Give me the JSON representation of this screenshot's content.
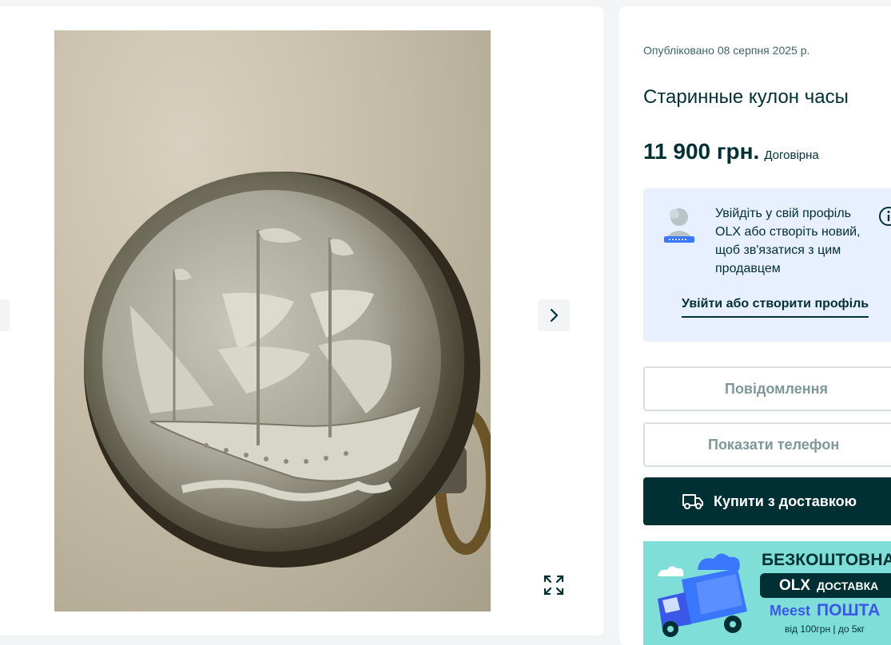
{
  "gallery": {
    "prev_icon": "chevron-left-icon",
    "next_icon": "chevron-right-icon",
    "expand_icon": "expand-icon"
  },
  "ad": {
    "published": "Опубліковано 08 серпня 2025 р.",
    "title": "Старинные кулон часы",
    "price": "11 900 грн.",
    "negotiable": "Договірна"
  },
  "login_prompt": {
    "text": "Увійдіть у свій профіль OLX або створіть новий, щоб зв'язатися з цим продавцем",
    "link": "Увійти або створити профіль",
    "info_icon": "info-icon"
  },
  "actions": {
    "message": "Повідомлення",
    "phone": "Показати телефон",
    "buy": "Купити з доставкою",
    "buy_icon": "truck-icon"
  },
  "banner": {
    "headline": "БЕЗКОШТОВНА",
    "olx_logo": "OLX",
    "olx_label": "ДОСТАВКА",
    "meest_logo": "Meest",
    "meest_poshta": "ПОШТА",
    "terms": "від 100грн | до 5кг"
  },
  "colors": {
    "primary": "#002f34",
    "login_bg": "#e8efff",
    "banner_bg": "#7fded8",
    "meest_blue": "#3a57e8"
  }
}
